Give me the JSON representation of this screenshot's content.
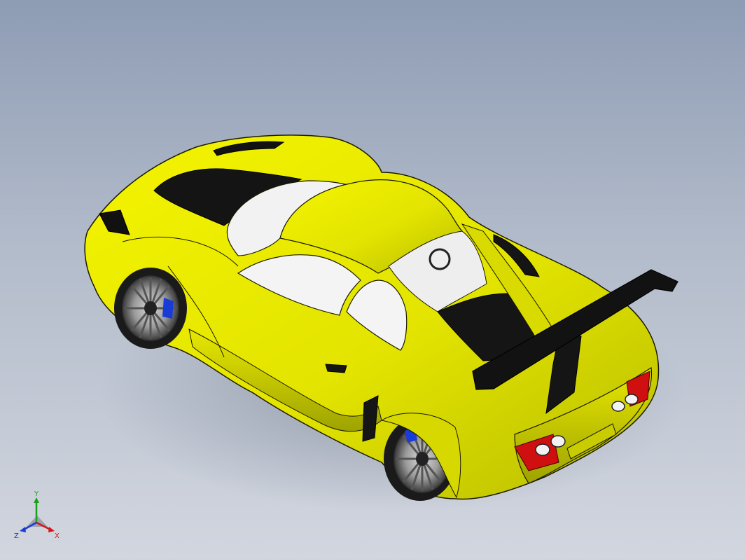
{
  "viewport": {
    "background_top": "#8e9cb4",
    "background_bottom": "#d2d6df"
  },
  "model": {
    "body_color": "#e6e600",
    "body_shadow_color": "#a3a800",
    "edge_color": "#1a1a00",
    "glass_color": "#f2f2f2",
    "trim_color": "#151515",
    "taillight_color": "#d01010",
    "brake_caliper_color": "#1a3cd6"
  },
  "triad": {
    "y_label": "Y",
    "x_label": "X",
    "z_label": "Z",
    "y_color": "#18a018",
    "x_color": "#d01818",
    "z_color": "#1a3ad0"
  }
}
